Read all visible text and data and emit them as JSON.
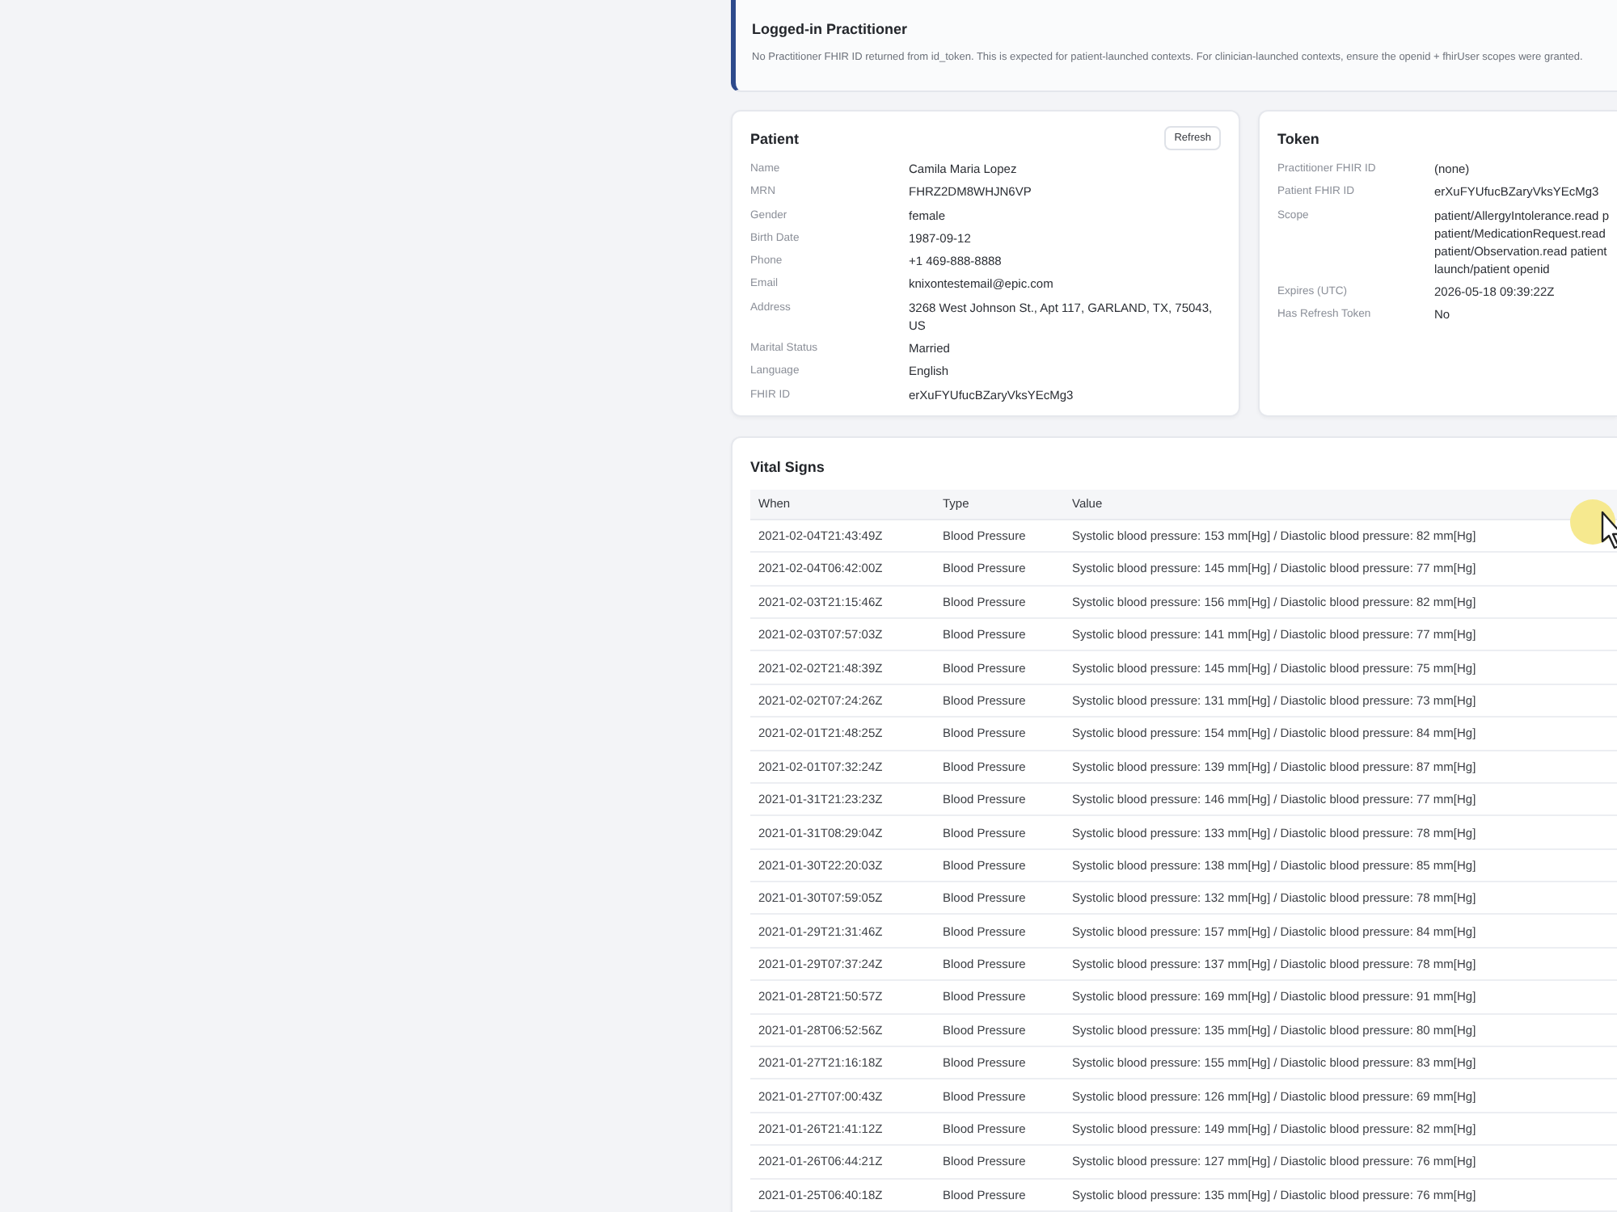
{
  "practitioner_notice": {
    "title": "Logged-in Practitioner",
    "message": "No Practitioner FHIR ID returned from id_token. This is expected for patient-launched contexts. For clinician-launched contexts, ensure the openid + fhirUser scopes were granted."
  },
  "patient": {
    "title": "Patient",
    "refresh_button": "Refresh",
    "fields": [
      {
        "label": "Name",
        "value": "Camila Maria Lopez"
      },
      {
        "label": "MRN",
        "value": "FHRZ2DM8WHJN6VP"
      },
      {
        "label": "Gender",
        "value": "female"
      },
      {
        "label": "Birth Date",
        "value": "1987-09-12"
      },
      {
        "label": "Phone",
        "value": "+1 469-888-8888"
      },
      {
        "label": "Email",
        "value": "knixontestemail@epic.com"
      },
      {
        "label": "Address",
        "value": "3268 West Johnson St., Apt 117, GARLAND, TX, 75043, US"
      },
      {
        "label": "Marital Status",
        "value": "Married"
      },
      {
        "label": "Language",
        "value": "English"
      },
      {
        "label": "FHIR ID",
        "value": "erXuFYUfucBZaryVksYEcMg3"
      }
    ]
  },
  "token": {
    "title": "Token",
    "fields": [
      {
        "label": "Practitioner FHIR ID",
        "value": "(none)"
      },
      {
        "label": "Patient FHIR ID",
        "value": "erXuFYUfucBZaryVksYEcMg3"
      },
      {
        "label": "Scope",
        "value": [
          "patient/AllergyIntolerance.read p",
          "patient/MedicationRequest.read",
          "patient/Observation.read patient",
          "launch/patient openid"
        ]
      },
      {
        "label": "Expires (UTC)",
        "value": "2026-05-18 09:39:22Z"
      },
      {
        "label": "Has Refresh Token",
        "value": "No"
      }
    ]
  },
  "vital_signs": {
    "title": "Vital Signs",
    "columns": [
      "When",
      "Type",
      "Value"
    ],
    "rows": [
      [
        "2021-02-04T21:43:49Z",
        "Blood Pressure",
        "Systolic blood pressure: 153 mm[Hg] / Diastolic blood pressure: 82 mm[Hg]"
      ],
      [
        "2021-02-04T06:42:00Z",
        "Blood Pressure",
        "Systolic blood pressure: 145 mm[Hg] / Diastolic blood pressure: 77 mm[Hg]"
      ],
      [
        "2021-02-03T21:15:46Z",
        "Blood Pressure",
        "Systolic blood pressure: 156 mm[Hg] / Diastolic blood pressure: 82 mm[Hg]"
      ],
      [
        "2021-02-03T07:57:03Z",
        "Blood Pressure",
        "Systolic blood pressure: 141 mm[Hg] / Diastolic blood pressure: 77 mm[Hg]"
      ],
      [
        "2021-02-02T21:48:39Z",
        "Blood Pressure",
        "Systolic blood pressure: 145 mm[Hg] / Diastolic blood pressure: 75 mm[Hg]"
      ],
      [
        "2021-02-02T07:24:26Z",
        "Blood Pressure",
        "Systolic blood pressure: 131 mm[Hg] / Diastolic blood pressure: 73 mm[Hg]"
      ],
      [
        "2021-02-01T21:48:25Z",
        "Blood Pressure",
        "Systolic blood pressure: 154 mm[Hg] / Diastolic blood pressure: 84 mm[Hg]"
      ],
      [
        "2021-02-01T07:32:24Z",
        "Blood Pressure",
        "Systolic blood pressure: 139 mm[Hg] / Diastolic blood pressure: 87 mm[Hg]"
      ],
      [
        "2021-01-31T21:23:23Z",
        "Blood Pressure",
        "Systolic blood pressure: 146 mm[Hg] / Diastolic blood pressure: 77 mm[Hg]"
      ],
      [
        "2021-01-31T08:29:04Z",
        "Blood Pressure",
        "Systolic blood pressure: 133 mm[Hg] / Diastolic blood pressure: 78 mm[Hg]"
      ],
      [
        "2021-01-30T22:20:03Z",
        "Blood Pressure",
        "Systolic blood pressure: 138 mm[Hg] / Diastolic blood pressure: 85 mm[Hg]"
      ],
      [
        "2021-01-30T07:59:05Z",
        "Blood Pressure",
        "Systolic blood pressure: 132 mm[Hg] / Diastolic blood pressure: 78 mm[Hg]"
      ],
      [
        "2021-01-29T21:31:46Z",
        "Blood Pressure",
        "Systolic blood pressure: 157 mm[Hg] / Diastolic blood pressure: 84 mm[Hg]"
      ],
      [
        "2021-01-29T07:37:24Z",
        "Blood Pressure",
        "Systolic blood pressure: 137 mm[Hg] / Diastolic blood pressure: 78 mm[Hg]"
      ],
      [
        "2021-01-28T21:50:57Z",
        "Blood Pressure",
        "Systolic blood pressure: 169 mm[Hg] / Diastolic blood pressure: 91 mm[Hg]"
      ],
      [
        "2021-01-28T06:52:56Z",
        "Blood Pressure",
        "Systolic blood pressure: 135 mm[Hg] / Diastolic blood pressure: 80 mm[Hg]"
      ],
      [
        "2021-01-27T21:16:18Z",
        "Blood Pressure",
        "Systolic blood pressure: 155 mm[Hg] / Diastolic blood pressure: 83 mm[Hg]"
      ],
      [
        "2021-01-27T07:00:43Z",
        "Blood Pressure",
        "Systolic blood pressure: 126 mm[Hg] / Diastolic blood pressure: 69 mm[Hg]"
      ],
      [
        "2021-01-26T21:41:12Z",
        "Blood Pressure",
        "Systolic blood pressure: 149 mm[Hg] / Diastolic blood pressure: 82 mm[Hg]"
      ],
      [
        "2021-01-26T06:44:21Z",
        "Blood Pressure",
        "Systolic blood pressure: 127 mm[Hg] / Diastolic blood pressure: 76 mm[Hg]"
      ],
      [
        "2021-01-25T06:40:18Z",
        "Blood Pressure",
        "Systolic blood pressure: 135 mm[Hg] / Diastolic blood pressure: 76 mm[Hg]"
      ]
    ]
  }
}
